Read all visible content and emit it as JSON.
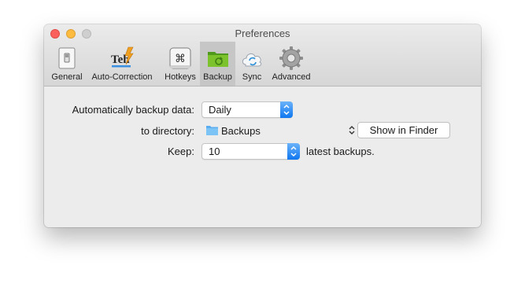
{
  "window": {
    "title": "Preferences"
  },
  "toolbar": {
    "tabs": [
      {
        "label": "General",
        "icon": "switch-icon"
      },
      {
        "label": "Auto-Correction",
        "icon": "teh-autocorrect-icon"
      },
      {
        "label": "Hotkeys",
        "icon": "command-key-icon"
      },
      {
        "label": "Backup",
        "icon": "green-folder-icon",
        "selected": true
      },
      {
        "label": "Sync",
        "icon": "cloud-sync-icon"
      },
      {
        "label": "Advanced",
        "icon": "gear-icon"
      }
    ]
  },
  "backup": {
    "frequency_label": "Automatically backup data:",
    "frequency_value": "Daily",
    "directory_label": "to directory:",
    "directory_value": "Backups",
    "show_in_finder": "Show in Finder",
    "keep_label": "Keep:",
    "keep_value": "10",
    "keep_suffix": "latest backups."
  },
  "colors": {
    "accent": "#1a7ff0",
    "close": "#fc605c",
    "minimize": "#fdbc40",
    "zoom_disabled": "#cfcfcf",
    "selected_tab": "#c6c6c6"
  }
}
